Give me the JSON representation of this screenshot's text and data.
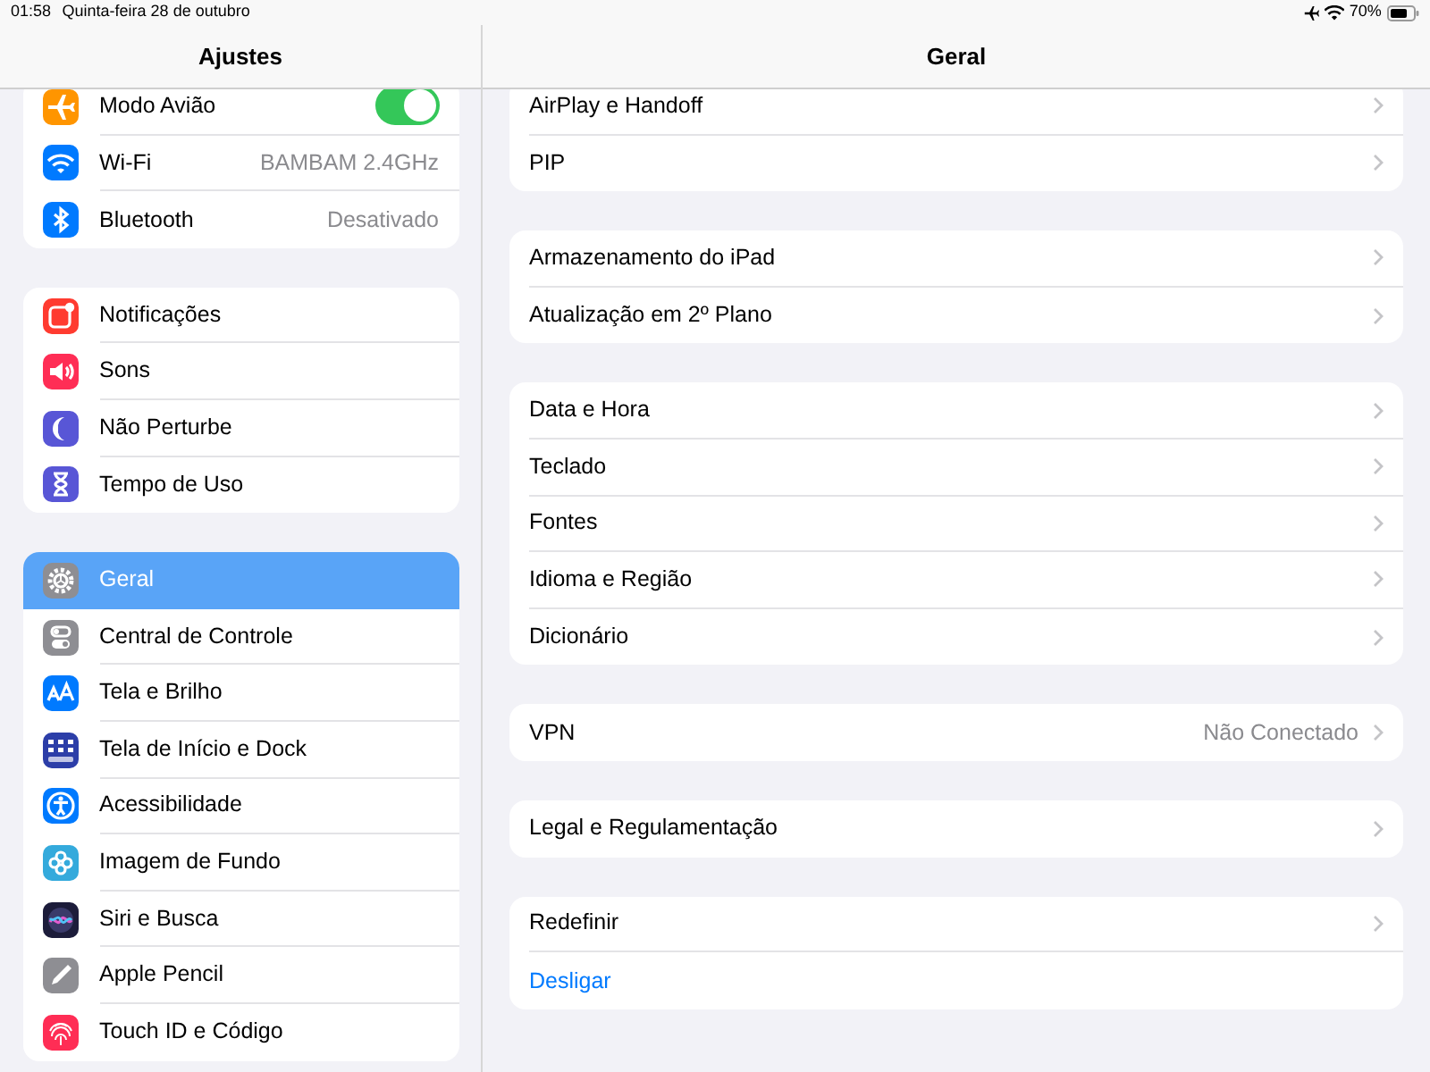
{
  "status_bar": {
    "time": "01:58",
    "date": "Quinta-feira 28 de outubro",
    "battery": "70%"
  },
  "sidebar": {
    "title": "Ajustes",
    "groups": [
      {
        "items": [
          {
            "label": "Modo Avião",
            "kind": "toggle",
            "on": true,
            "selected": false,
            "color": "#ff9500"
          },
          {
            "label": "Wi-Fi",
            "kind": "value",
            "value": "BAMBAM 2.4GHz",
            "selected": false,
            "color": "#007aff"
          },
          {
            "label": "Bluetooth",
            "kind": "value",
            "value": "Desativado",
            "selected": false,
            "color": "#007aff"
          }
        ]
      },
      {
        "items": [
          {
            "label": "Notificações",
            "kind": "plain",
            "selected": false,
            "color": "#ff3b30"
          },
          {
            "label": "Sons",
            "kind": "plain",
            "selected": false,
            "color": "#ff2d55"
          },
          {
            "label": "Não Perturbe",
            "kind": "plain",
            "selected": false,
            "color": "#5856d6"
          },
          {
            "label": "Tempo de Uso",
            "kind": "plain",
            "selected": false,
            "color": "#5856d6"
          }
        ]
      },
      {
        "items": [
          {
            "label": "Geral",
            "kind": "plain",
            "selected": true,
            "color": "#8e8e93"
          },
          {
            "label": "Central de Controle",
            "kind": "plain",
            "selected": false,
            "color": "#8e8e93"
          },
          {
            "label": "Tela e Brilho",
            "kind": "plain",
            "selected": false,
            "color": "#007aff"
          },
          {
            "label": "Tela de Início e Dock",
            "kind": "plain",
            "selected": false,
            "color": "#2c3ea8"
          },
          {
            "label": "Acessibilidade",
            "kind": "plain",
            "selected": false,
            "color": "#007aff"
          },
          {
            "label": "Imagem de Fundo",
            "kind": "plain",
            "selected": false,
            "color": "#34aadc"
          },
          {
            "label": "Siri e Busca",
            "kind": "plain",
            "selected": false,
            "color": "#1c1c3a"
          },
          {
            "label": "Apple Pencil",
            "kind": "plain",
            "selected": false,
            "color": "#8e8e93"
          },
          {
            "label": "Touch ID e Código",
            "kind": "plain",
            "selected": false,
            "color": "#ff2d55"
          }
        ]
      }
    ]
  },
  "detail": {
    "title": "Geral",
    "groups": [
      {
        "rows": [
          {
            "label": "AirPlay e Handoff",
            "kind": "chevron"
          },
          {
            "label": "PIP",
            "kind": "chevron"
          }
        ]
      },
      {
        "rows": [
          {
            "label": "Armazenamento do iPad",
            "kind": "chevron"
          },
          {
            "label": "Atualização em 2º Plano",
            "kind": "chevron"
          }
        ]
      },
      {
        "rows": [
          {
            "label": "Data e Hora",
            "kind": "chevron"
          },
          {
            "label": "Teclado",
            "kind": "chevron"
          },
          {
            "label": "Fontes",
            "kind": "chevron"
          },
          {
            "label": "Idioma e Região",
            "kind": "chevron"
          },
          {
            "label": "Dicionário",
            "kind": "chevron"
          }
        ]
      },
      {
        "rows": [
          {
            "label": "VPN",
            "kind": "chevron",
            "value": "Não Conectado"
          }
        ]
      },
      {
        "rows": [
          {
            "label": "Legal e Regulamentação",
            "kind": "chevron"
          }
        ]
      },
      {
        "rows": [
          {
            "label": "Redefinir",
            "kind": "chevron"
          },
          {
            "label": "Desligar",
            "kind": "link"
          }
        ]
      }
    ]
  }
}
